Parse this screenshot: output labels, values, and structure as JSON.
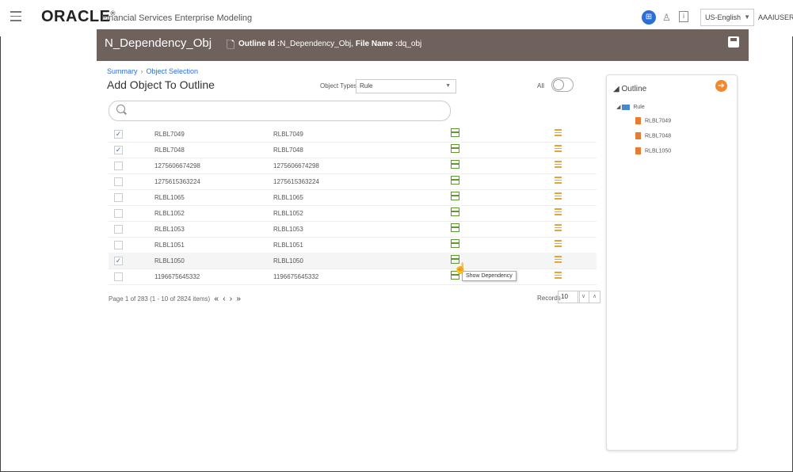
{
  "header": {
    "logo": "ORACLE",
    "product": "Financial Services Enterprise Modeling",
    "language": "US-English",
    "user": "AAAIUSER"
  },
  "titlebar": {
    "title": "N_Dependency_Obj",
    "outline_label": "Outline Id :",
    "outline_id": "N_Dependency_Obj,",
    "file_label": "File Name :",
    "file_name": "dq_obj"
  },
  "breadcrumb": {
    "summary": "Summary",
    "current": "Object Selection"
  },
  "page": {
    "heading": "Add Object To Outline",
    "object_types_label": "Object Types",
    "object_type_value": "Rule",
    "all_label": "All"
  },
  "rows": [
    {
      "checked": true,
      "col1": "RLBL7049",
      "col2": "RLBL7049"
    },
    {
      "checked": true,
      "col1": "RLBL7048",
      "col2": "RLBL7048"
    },
    {
      "checked": false,
      "col1": "1275606674298",
      "col2": "1275606674298"
    },
    {
      "checked": false,
      "col1": "1275615363224",
      "col2": "1275615363224"
    },
    {
      "checked": false,
      "col1": "RLBL1065",
      "col2": "RLBL1065"
    },
    {
      "checked": false,
      "col1": "RLBL1052",
      "col2": "RLBL1052"
    },
    {
      "checked": false,
      "col1": "RLBL1053",
      "col2": "RLBL1053"
    },
    {
      "checked": false,
      "col1": "RLBL1051",
      "col2": "RLBL1051"
    },
    {
      "checked": true,
      "col1": "RLBL1050",
      "col2": "RLBL1050"
    },
    {
      "checked": false,
      "col1": "1196675645332",
      "col2": "1196675645332"
    }
  ],
  "tooltip": "Show Dependency",
  "pager": {
    "page_label": "Page",
    "page": "1",
    "of_label": "of",
    "total_pages": "283",
    "items": "(1 - 10 of 2824 items)",
    "records_label": "Records",
    "records_value": "10"
  },
  "outline": {
    "title": "Outline",
    "folder": "Rule",
    "items": [
      "RLBL7049",
      "RLBL7048",
      "RLBL1050"
    ]
  },
  "colors": {
    "accent": "#2a6ed6",
    "header_bg": "#6f625c",
    "go_button": "#f08a2f"
  }
}
